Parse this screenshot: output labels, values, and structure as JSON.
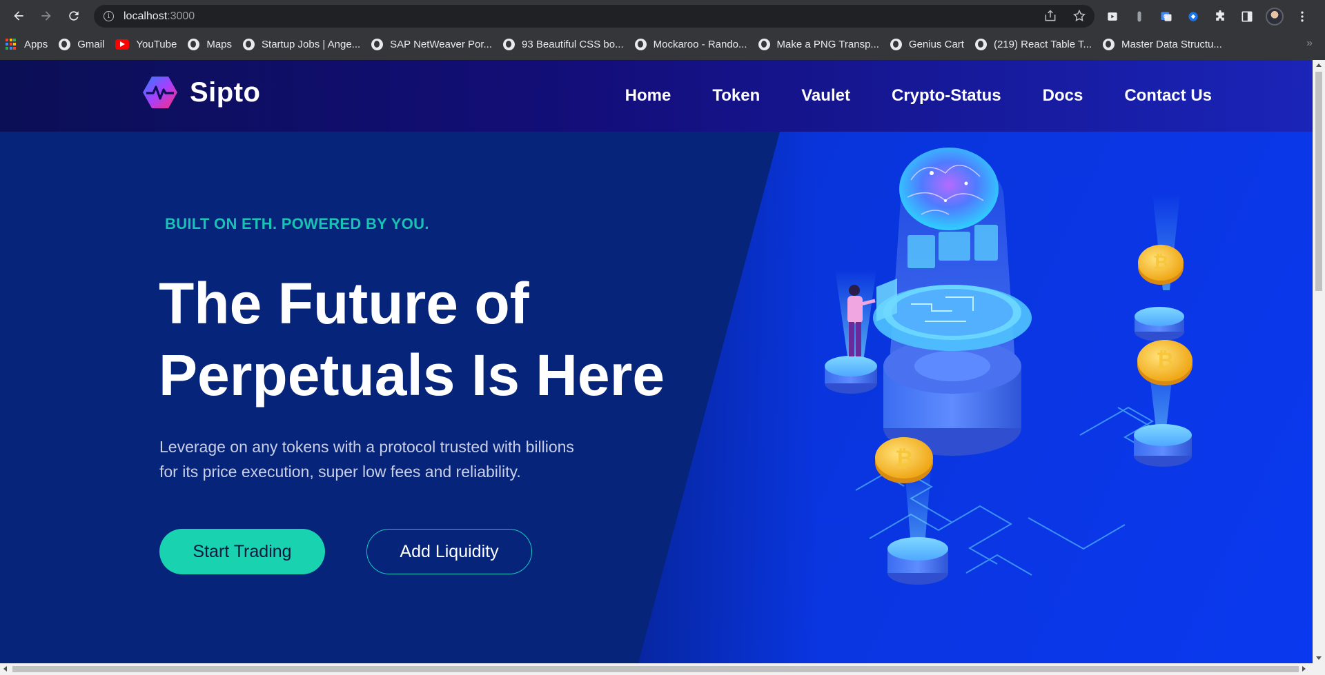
{
  "browser": {
    "url_host": "localhost",
    "url_port": ":3000",
    "bookmarks": [
      {
        "label": "Apps",
        "icon": "apps-icon"
      },
      {
        "label": "Gmail",
        "icon": "globe-icon"
      },
      {
        "label": "YouTube",
        "icon": "youtube-icon"
      },
      {
        "label": "Maps",
        "icon": "globe-icon"
      },
      {
        "label": "Startup Jobs | Ange...",
        "icon": "globe-icon"
      },
      {
        "label": "SAP NetWeaver Por...",
        "icon": "globe-icon"
      },
      {
        "label": "93 Beautiful CSS bo...",
        "icon": "globe-icon"
      },
      {
        "label": "Mockaroo - Rando...",
        "icon": "globe-icon"
      },
      {
        "label": "Make a PNG Transp...",
        "icon": "globe-icon"
      },
      {
        "label": "Genius Cart",
        "icon": "globe-icon"
      },
      {
        "label": "(219) React Table T...",
        "icon": "globe-icon"
      },
      {
        "label": "Master Data Structu...",
        "icon": "globe-icon"
      }
    ],
    "bookmarks_overflow": "»"
  },
  "site": {
    "brand": "Sipto",
    "nav": [
      "Home",
      "Token",
      "Vaulet",
      "Crypto-Status",
      "Docs",
      "Contact Us"
    ]
  },
  "hero": {
    "eyebrow": "BUILT ON ETH. POWERED BY YOU.",
    "headline_line1": "The Future of",
    "headline_line2": "Perpetuals Is Here",
    "subtitle_line1": "Leverage on any tokens with a protocol trusted with billions",
    "subtitle_line2": "for its price execution, super low fees and reliability.",
    "primary_cta": "Start Trading",
    "secondary_cta": "Add Liquidity",
    "illustration": "isometric-crypto-ai-illustration"
  },
  "colors": {
    "accent_teal": "#19d3b0",
    "hero_bg": "#06247a",
    "header_bg": "#130e7a",
    "coin_gold": "#f5b82e"
  }
}
